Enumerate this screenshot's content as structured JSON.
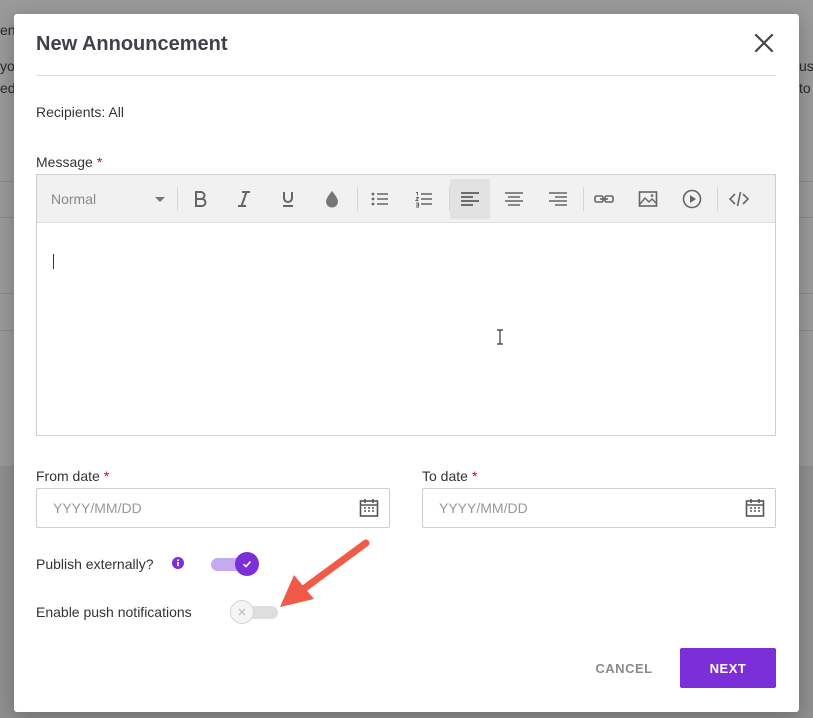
{
  "background": {
    "left_fragments": [
      "en",
      "yo",
      "ed"
    ],
    "right_fragments": [
      "us",
      "to"
    ]
  },
  "modal": {
    "title": "New Announcement",
    "close_icon": "close-icon",
    "recipients_label": "Recipients: All",
    "message": {
      "label": "Message",
      "required_mark": "*",
      "value": "",
      "toolbar": {
        "format_select": "Normal",
        "buttons": [
          "bold-icon",
          "italic-icon",
          "underline-icon",
          "color-drop-icon",
          "bullet-list-icon",
          "numbered-list-icon",
          "align-left-icon",
          "align-center-icon",
          "align-right-icon",
          "link-icon",
          "image-icon",
          "video-icon",
          "code-icon"
        ],
        "active_button": "align-left-icon"
      }
    },
    "from_date": {
      "label": "From date",
      "required_mark": "*",
      "placeholder": "YYYY/MM/DD",
      "value": ""
    },
    "to_date": {
      "label": "To date",
      "required_mark": "*",
      "placeholder": "YYYY/MM/DD",
      "value": ""
    },
    "publish_externally": {
      "label": "Publish externally?",
      "enabled": true
    },
    "push_notifications": {
      "label": "Enable push notifications",
      "enabled": false
    },
    "cancel_label": "CANCEL",
    "next_label": "NEXT"
  },
  "colors": {
    "accent": "#7c2fd8",
    "accent_light": "#c6a9f1",
    "required": "#d0021b",
    "annotation_arrow": "#f05a48"
  }
}
